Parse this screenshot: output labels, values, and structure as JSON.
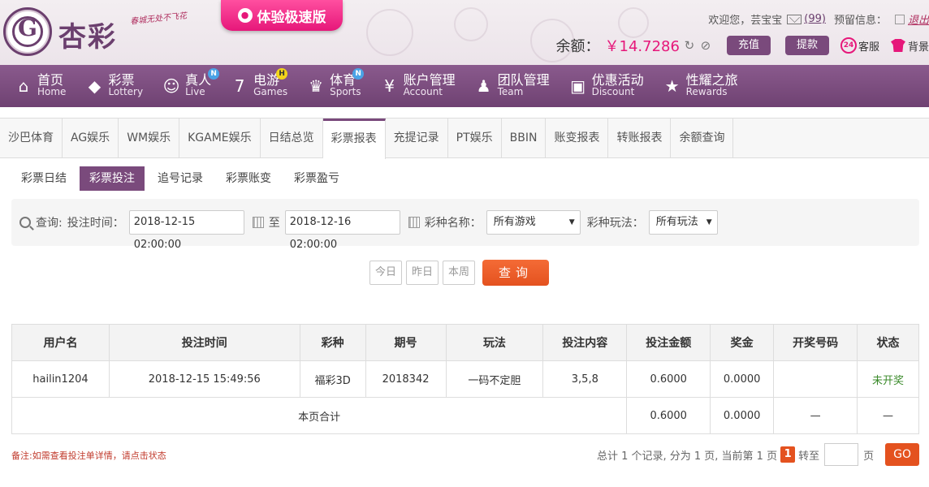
{
  "header": {
    "brand": "杏彩",
    "slogan": "春城无处不飞花",
    "speed_label": "体验极速版",
    "welcome": "欢迎您，",
    "username": "芸宝宝",
    "message_count": "(99)",
    "notice_label": "预留信息：",
    "logout": "退出",
    "balance_label": "余额：",
    "balance_value": "￥14.7286",
    "recharge": "充值",
    "withdraw": "提款",
    "service": "客服",
    "background": "背景"
  },
  "nav": [
    {
      "cn": "首页",
      "en": "Home",
      "icon": "home-icon"
    },
    {
      "cn": "彩票",
      "en": "Lottery",
      "icon": "lottery-icon"
    },
    {
      "cn": "真人",
      "en": "Live",
      "icon": "dealer-icon",
      "badge": "N"
    },
    {
      "cn": "电游",
      "en": "Games",
      "icon": "slot-icon",
      "badge": "H"
    },
    {
      "cn": "体育",
      "en": "Sports",
      "icon": "trophy-icon",
      "badge": "N"
    },
    {
      "cn": "账户管理",
      "en": "Account",
      "icon": "account-icon"
    },
    {
      "cn": "团队管理",
      "en": "Team",
      "icon": "team-icon"
    },
    {
      "cn": "优惠活动",
      "en": "Discount",
      "icon": "gift-icon"
    },
    {
      "cn": "性耀之旅",
      "en": "Rewards",
      "icon": "rewards-icon"
    }
  ],
  "tabs": [
    "沙巴体育",
    "AG娱乐",
    "WM娱乐",
    "KGAME娱乐",
    "日结总览",
    "彩票报表",
    "充提记录",
    "PT娱乐",
    "BBIN",
    "账变报表",
    "转账报表",
    "余额查询"
  ],
  "active_tab": 5,
  "subtabs": [
    "彩票日结",
    "彩票投注",
    "追号记录",
    "彩票账变",
    "彩票盈亏"
  ],
  "active_subtab": 1,
  "filter": {
    "query_label": "查询:",
    "time_label": "投注时间：",
    "start": "2018-12-15 02:00:00",
    "to": "至",
    "end": "2018-12-16 02:00:00",
    "lottery_label": "彩种名称：",
    "lottery_value": "所有游戏",
    "play_label": "彩种玩法：",
    "play_value": "所有玩法"
  },
  "quick": {
    "today": "今日",
    "yesterday": "昨日",
    "week": "本周",
    "search": "查询"
  },
  "table": {
    "headers": [
      "用户名",
      "投注时间",
      "彩种",
      "期号",
      "玩法",
      "投注内容",
      "投注金额",
      "奖金",
      "开奖号码",
      "状态"
    ],
    "rows": [
      [
        "hailin1204",
        "2018-12-15 15:49:56",
        "福彩3D",
        "2018342",
        "一码不定胆",
        "3,5,8",
        "0.6000",
        "0.0000",
        "",
        "未开奖"
      ]
    ],
    "total": {
      "label": "本页合计",
      "amount": "0.6000",
      "bonus": "0.0000",
      "draw": "—",
      "status": "—"
    }
  },
  "footer": {
    "note": "备注:如需查看投注单详情，请点击状态",
    "summary": "总计 1 个记录, 分为 1 页, 当前第 1 页",
    "current_page": "1",
    "goto": "转至",
    "page_unit": "页",
    "go": "GO"
  }
}
